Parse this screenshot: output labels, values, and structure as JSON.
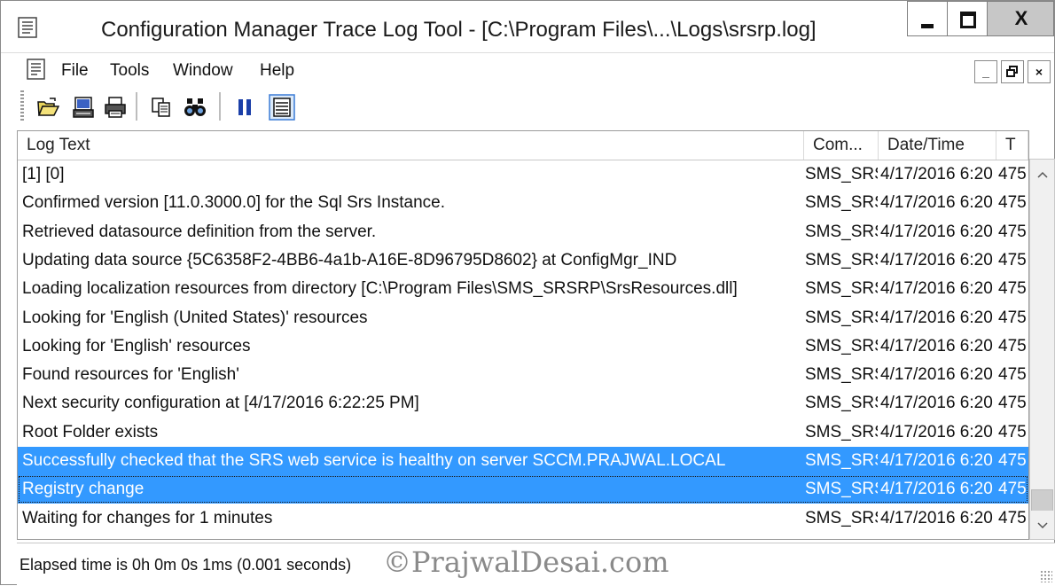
{
  "window": {
    "title": "Configuration Manager Trace Log Tool - [C:\\Program Files\\...\\Logs\\srsrp.log]",
    "close_glyph": "X"
  },
  "menu": {
    "items": [
      {
        "label": "File"
      },
      {
        "label": "Tools"
      },
      {
        "label": "Window"
      },
      {
        "label": "Help"
      }
    ],
    "mdi_min": "_",
    "mdi_restore": "🗗",
    "mdi_close": "×"
  },
  "toolbar": {
    "buttons": [
      "open-icon",
      "print-preview-icon",
      "print-icon",
      "copy-icon",
      "find-icon",
      "pause-icon",
      "highlight-icon"
    ]
  },
  "log": {
    "columns": [
      {
        "label": "Log Text"
      },
      {
        "label": "Com..."
      },
      {
        "label": "Date/Time"
      },
      {
        "label": "T"
      }
    ],
    "rows": [
      {
        "text": "[1] [0]",
        "component": "SMS_SRS",
        "datetime": "4/17/2016 6:20",
        "thread": "475"
      },
      {
        "text": "Confirmed version [11.0.3000.0] for the Sql Srs Instance.",
        "component": "SMS_SRS",
        "datetime": "4/17/2016 6:20",
        "thread": "475"
      },
      {
        "text": "Retrieved datasource definition from the server.",
        "component": "SMS_SRS",
        "datetime": "4/17/2016 6:20",
        "thread": "475"
      },
      {
        "text": "Updating data source {5C6358F2-4BB6-4a1b-A16E-8D96795D8602} at ConfigMgr_IND",
        "component": "SMS_SRS",
        "datetime": "4/17/2016 6:20",
        "thread": "475"
      },
      {
        "text": "Loading localization resources from directory [C:\\Program Files\\SMS_SRSRP\\SrsResources.dll]",
        "component": "SMS_SRS",
        "datetime": "4/17/2016 6:20",
        "thread": "475"
      },
      {
        "text": "Looking for 'English (United States)' resources",
        "component": "SMS_SRS",
        "datetime": "4/17/2016 6:20",
        "thread": "475"
      },
      {
        "text": "Looking for 'English' resources",
        "component": "SMS_SRS",
        "datetime": "4/17/2016 6:20",
        "thread": "475"
      },
      {
        "text": "Found resources for 'English'",
        "component": "SMS_SRS",
        "datetime": "4/17/2016 6:20",
        "thread": "475"
      },
      {
        "text": "Next security configuration at [4/17/2016 6:22:25 PM]",
        "component": "SMS_SRS",
        "datetime": "4/17/2016 6:20",
        "thread": "475"
      },
      {
        "text": "Root Folder exists",
        "component": "SMS_SRS",
        "datetime": "4/17/2016 6:20",
        "thread": "475"
      },
      {
        "text": "Successfully checked that the SRS web service is healthy on server SCCM.PRAJWAL.LOCAL",
        "component": "SMS_SRS",
        "datetime": "4/17/2016 6:20",
        "thread": "475"
      },
      {
        "text": "Registry change",
        "component": "SMS_SRS",
        "datetime": "4/17/2016 6:20",
        "thread": "475"
      },
      {
        "text": "Waiting for changes for 1 minutes",
        "component": "SMS_SRS",
        "datetime": "4/17/2016 6:20",
        "thread": "475"
      }
    ],
    "selected_rows": [
      10,
      11
    ],
    "focused_row": 11
  },
  "scrollbar": {
    "up_glyph": "^",
    "down_glyph": "v"
  },
  "status": {
    "elapsed": "Elapsed time is 0h 0m 0s 1ms (0.001 seconds)",
    "watermark": "©PrajwalDesai.com"
  },
  "colors": {
    "selection": "#3399ff"
  }
}
